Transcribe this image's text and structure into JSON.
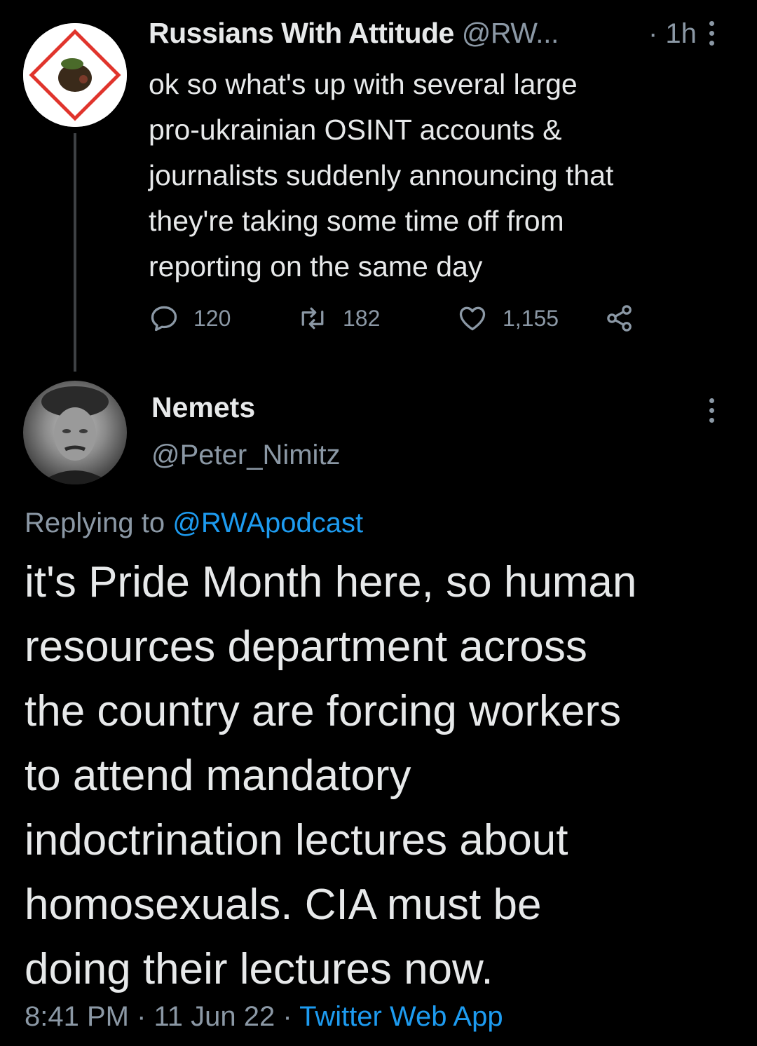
{
  "parent_tweet": {
    "author_name": "Russians With Attitude",
    "author_handle": "@RW...",
    "time": "· 1h",
    "text": "ok so what's up with several large\npro-ukrainian OSINT accounts &\njournalists suddenly announcing that\nthey're taking some time off from\nreporting on the same day",
    "replies": "120",
    "retweets": "182",
    "likes": "1,155"
  },
  "reply_tweet": {
    "author_name": "Nemets",
    "author_handle": "@Peter_Nimitz",
    "replying_prefix": "Replying to ",
    "replying_to": "@RWApodcast",
    "text": "it's Pride Month here, so human\nresources department across\nthe country are forcing workers\nto attend mandatory\nindoctrination lectures about\nhomosexuals. CIA must be\ndoing their lectures now.",
    "time": "8:41 PM",
    "sep1": " · ",
    "date": "11 Jun 22",
    "sep2": " · ",
    "source": "Twitter Web App"
  },
  "colors": {
    "background": "#000000",
    "text": "#e7e9ea",
    "muted": "#8b98a5",
    "link": "#1d9bf0"
  }
}
